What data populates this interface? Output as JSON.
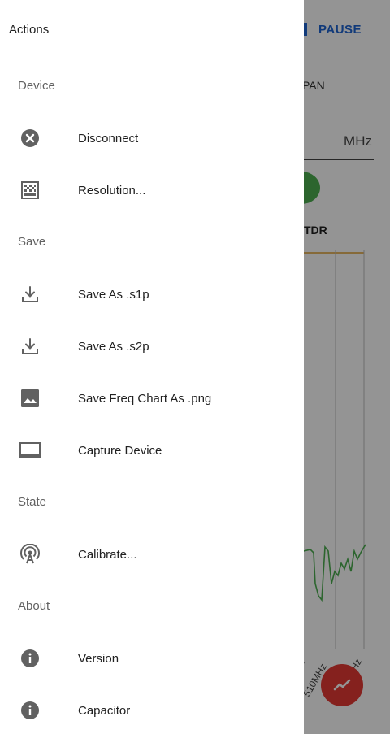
{
  "background": {
    "pause_label": "PAUSE",
    "span_label": "PAN",
    "unit_label": "MHz",
    "chart_title": "TDR",
    "axis_labels": [
      "z",
      "510MHz",
      "Hz"
    ]
  },
  "drawer": {
    "title": "Actions",
    "sections": {
      "device": "Device",
      "save": "Save",
      "state": "State",
      "about": "About"
    },
    "items": {
      "disconnect": "Disconnect",
      "resolution": "Resolution...",
      "save_s1p": "Save As .s1p",
      "save_s2p": "Save As .s2p",
      "save_png": "Save Freq Chart As .png",
      "capture": "Capture Device",
      "calibrate": "Calibrate...",
      "version": "Version",
      "capacitor": "Capacitor"
    }
  },
  "colors": {
    "accent": "#1e64d2",
    "fab": "#e53935",
    "icon": "#616161",
    "trace_green": "#4caf50",
    "trace_orange": "#e0a030"
  }
}
